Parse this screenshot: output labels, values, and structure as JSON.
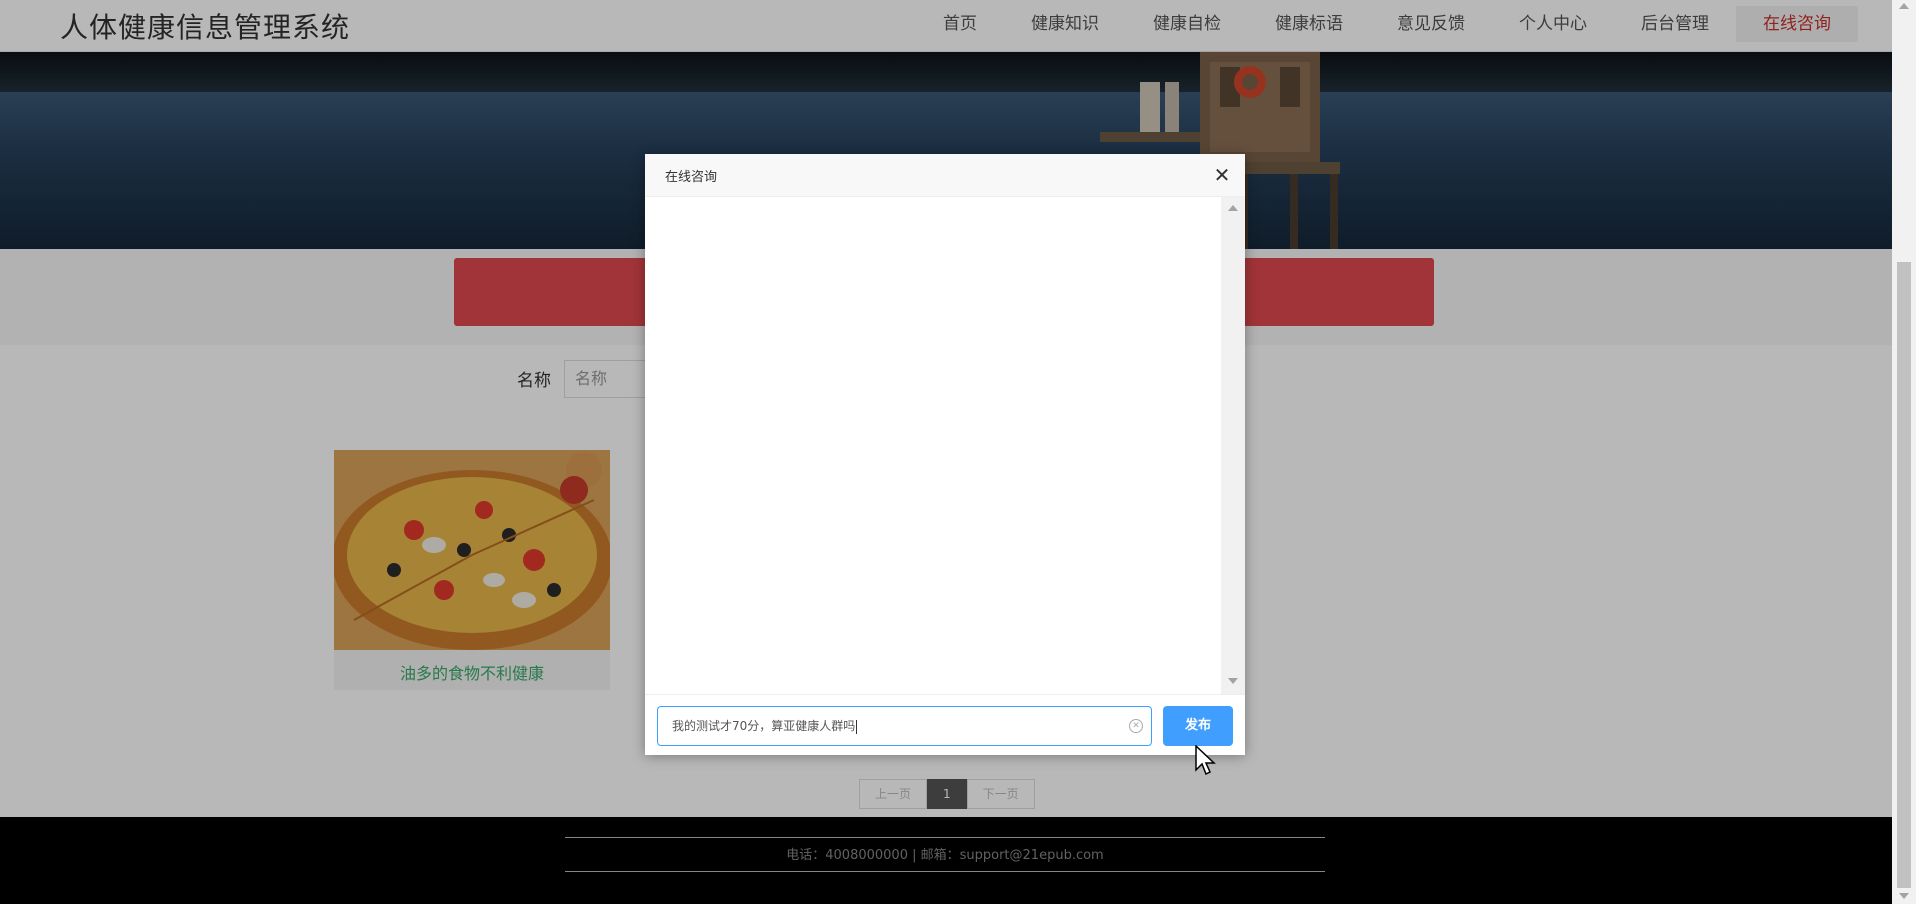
{
  "header": {
    "logo": "人体健康信息管理系统",
    "nav": [
      "首页",
      "健康知识",
      "健康自检",
      "健康标语",
      "意见反馈",
      "个人中心",
      "后台管理",
      "在线咨询"
    ],
    "active_nav": "在线咨询"
  },
  "search": {
    "label": "名称",
    "placeholder": "名称"
  },
  "card": {
    "title": "油多的食物不利健康"
  },
  "pagination": {
    "prev": "上一页",
    "current": "1",
    "next": "下一页"
  },
  "footer": {
    "text": "电话：4008000000 | 邮箱：support@21epub.com"
  },
  "dialog": {
    "title": "在线咨询",
    "input_value": "我的测试才70分，算亚健康人群吗",
    "send_label": "发布"
  },
  "colors": {
    "accent": "#409eff",
    "active_nav": "#c9302c",
    "banner_bar": "#e0494e",
    "card_title": "#3aa86a"
  }
}
